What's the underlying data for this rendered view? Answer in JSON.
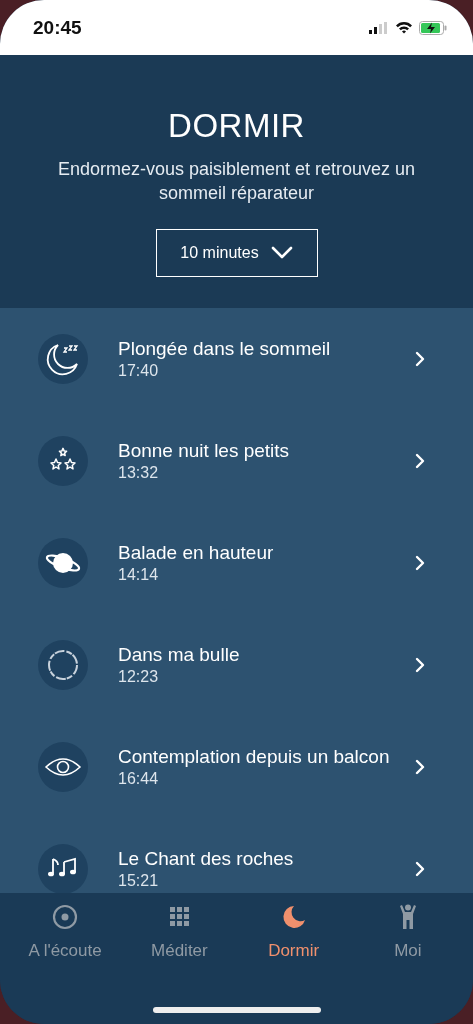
{
  "status_bar": {
    "time": "20:45"
  },
  "header": {
    "title": "DORMIR",
    "subtitle": "Endormez-vous paisiblement et retrouvez un sommeil réparateur",
    "duration": "10 minutes"
  },
  "sessions": [
    {
      "kind": "moon",
      "title": "Plongée dans le sommeil",
      "duration": "17:40"
    },
    {
      "kind": "stars",
      "title": "Bonne nuit les petits",
      "duration": "13:32"
    },
    {
      "kind": "planet",
      "title": "Balade en hauteur",
      "duration": "14:14"
    },
    {
      "kind": "ring",
      "title": "Dans ma bulle",
      "duration": "12:23"
    },
    {
      "kind": "eye",
      "title": "Contemplation depuis un balcon",
      "duration": "16:44"
    },
    {
      "kind": "music",
      "title": "Le Chant des roches",
      "duration": "15:21"
    }
  ],
  "tab_bar": [
    {
      "kind": "listen",
      "label": "A l'écoute",
      "selected": false
    },
    {
      "kind": "grid",
      "label": "Méditer",
      "selected": false
    },
    {
      "kind": "moon",
      "label": "Dormir",
      "selected": true
    },
    {
      "kind": "person",
      "label": "Moi",
      "selected": false
    }
  ]
}
